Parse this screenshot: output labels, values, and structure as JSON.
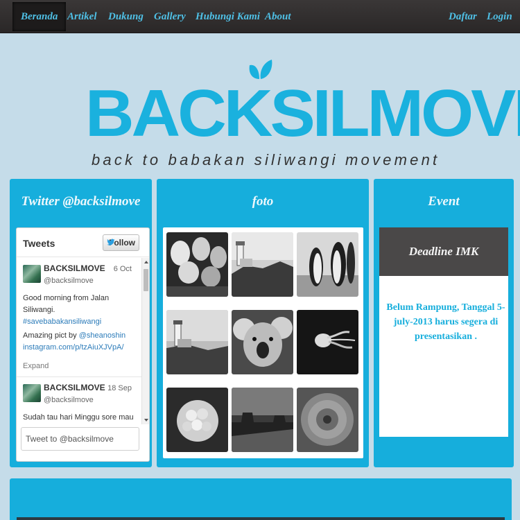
{
  "nav": {
    "left": [
      "Beranda",
      "Artikel",
      "Dukung",
      "Gallery",
      "Hubungi Kami",
      "About"
    ],
    "right": [
      "Daftar",
      "Login"
    ],
    "active": "Beranda"
  },
  "logo": {
    "title": "BACKSILMOVE",
    "subtitle": "back to babakan siliwangi movement"
  },
  "twitter": {
    "title": "Twitter @backsilmove",
    "tweets_label": "Tweets",
    "follow_label": "Follow",
    "tweets": [
      {
        "name": "BACKSILMOVE",
        "handle": "@backsilmove",
        "date": "6 Oct",
        "text_1": "Good morning from Jalan Siliwangi.",
        "hashtag": "#savebabakansiliwangi",
        "text_2": "Amazing pict by",
        "mention": "@sheanoshin",
        "link": "instagram.com/p/tzAiuXJVpA/",
        "expand": "Expand"
      },
      {
        "name": "BACKSILMOVE",
        "handle": "@backsilmove",
        "date": "18 Sep",
        "text_1": "Sudah tau hari Minggu sore mau"
      }
    ],
    "input_placeholder": "Tweet to @backsilmove"
  },
  "foto": {
    "title": "foto",
    "photos": [
      "tulips",
      "lighthouse",
      "penguins",
      "lighthouse-2",
      "koala",
      "jellyfish",
      "hydrangea",
      "desert",
      "chrysanthemum"
    ]
  },
  "event": {
    "title": "Event",
    "heading": "Deadline IMK",
    "body": "Belum Rampung, Tanggal 5-july-2013 harus segera di presentasikan ."
  },
  "colors": {
    "accent": "#16aedc",
    "nav_text": "#4fc0e6",
    "background": "#c5dce9",
    "nav_bg": "#2f2c2c"
  }
}
